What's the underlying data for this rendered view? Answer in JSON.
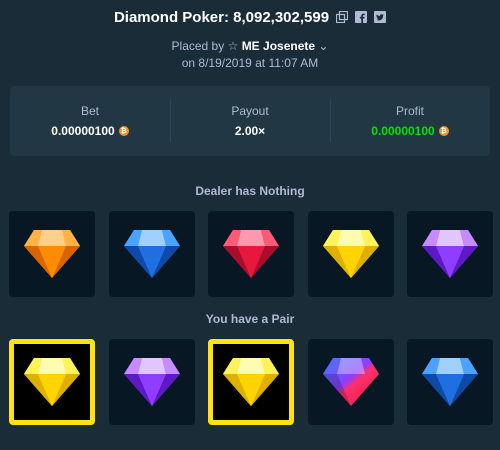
{
  "header": {
    "title": "Diamond Poker: 8,092,302,599",
    "icons": [
      "copy-icon",
      "facebook-icon",
      "twitter-icon"
    ]
  },
  "placed": {
    "prefix": "Placed by",
    "user": "ME Josenete",
    "date": "on 8/19/2019 at 11:07 AM"
  },
  "stats": {
    "bet_label": "Bet",
    "bet_value": "0.00000100",
    "payout_label": "Payout",
    "payout_value": "2.00×",
    "profit_label": "Profit",
    "profit_value": "0.00000100"
  },
  "dealer": {
    "label": "Dealer has Nothing",
    "gems": [
      "orange",
      "blue",
      "red",
      "yellow",
      "purple"
    ]
  },
  "player": {
    "label": "You have a Pair",
    "gems": [
      "yellow",
      "purple",
      "yellow",
      "multi",
      "blue"
    ],
    "highlighted": [
      true,
      false,
      true,
      false,
      false
    ]
  },
  "colors": {
    "background": "#1a2c38",
    "panel": "#213743",
    "profit_green": "#00e701",
    "highlight": "#ffe20e",
    "btc": "#f7931a"
  }
}
